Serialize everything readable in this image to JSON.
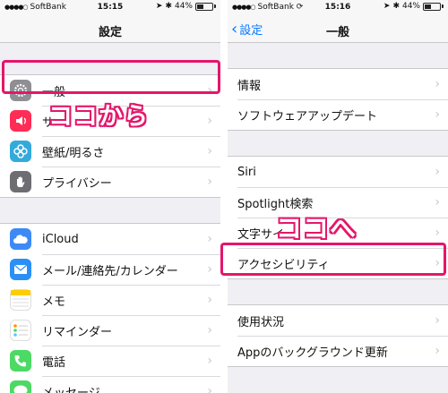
{
  "left": {
    "status": {
      "carrier": "SoftBank",
      "time": "15:15",
      "battery": "44%",
      "battery_level": 0.44
    },
    "nav": {
      "title": "設定"
    },
    "groups": [
      {
        "items": [
          {
            "label": "一般",
            "icon": "gear-icon",
            "color": "#8e8e93"
          },
          {
            "label": "サ",
            "icon": "speaker-icon",
            "color": "#ff2d55"
          },
          {
            "label": "壁紙/明るさ",
            "icon": "flower-icon",
            "color": "#34aadc"
          },
          {
            "label": "プライバシー",
            "icon": "hand-icon",
            "color": "#6d6d72"
          }
        ]
      },
      {
        "items": [
          {
            "label": "iCloud",
            "icon": "cloud-icon",
            "color": "#3d8af7"
          },
          {
            "label": "メール/連絡先/カレンダー",
            "icon": "envelope-icon",
            "color": "#2a90f5"
          },
          {
            "label": "メモ",
            "icon": "notes-icon",
            "color": "#ffcc00"
          },
          {
            "label": "リマインダー",
            "icon": "reminders-icon",
            "color": "#ffffff"
          },
          {
            "label": "電話",
            "icon": "phone-icon",
            "color": "#4cd964"
          },
          {
            "label": "メッセージ",
            "icon": "message-icon",
            "color": "#4cd964"
          }
        ]
      }
    ],
    "annotation": "ココから"
  },
  "right": {
    "status": {
      "carrier": "SoftBank",
      "time": "15:16",
      "battery": "44%",
      "battery_level": 0.44
    },
    "nav": {
      "title": "一般",
      "back": "設定"
    },
    "groups": [
      {
        "items": [
          {
            "label": "情報"
          },
          {
            "label": "ソフトウェアアップデート"
          }
        ]
      },
      {
        "items": [
          {
            "label": "Siri"
          },
          {
            "label": "Spotlight検索"
          },
          {
            "label": "文字サイ"
          },
          {
            "label": "アクセシビリティ"
          }
        ]
      },
      {
        "items": [
          {
            "label": "使用状況"
          },
          {
            "label": "Appのバックグラウンド更新"
          }
        ]
      }
    ],
    "annotation": "ココへ"
  },
  "colors": {
    "accent": "#e4166b",
    "ios_blue": "#0a7aff"
  }
}
